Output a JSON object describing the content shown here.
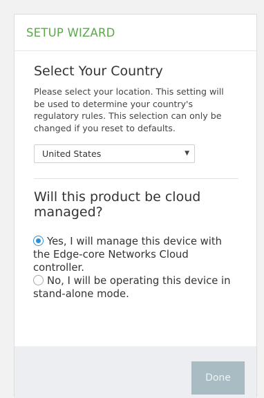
{
  "header": {
    "title": "SETUP WIZARD"
  },
  "country": {
    "title": "Select Your Country",
    "description": "Please select your location. This setting will be used to determine your country's regulatory rules. This selection can only be changed if you reset to defaults.",
    "selected": "United States"
  },
  "cloud": {
    "title": "Will this product be cloud managed?",
    "options": [
      {
        "label": "Yes, I will manage this device with the Edge-core Networks Cloud controller.",
        "selected": true
      },
      {
        "label": "No, I will be operating this device in stand-alone mode.",
        "selected": false
      }
    ]
  },
  "footer": {
    "done_label": "Done"
  },
  "colors": {
    "accent": "#5ba84a",
    "radio": "#2f8fd6",
    "button": "#a9bcc4"
  }
}
